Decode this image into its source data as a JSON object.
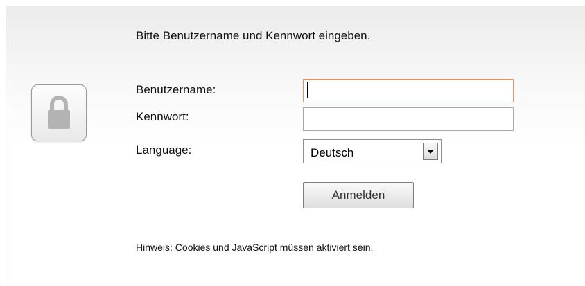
{
  "login": {
    "heading": "Bitte Benutzername und Kennwort eingeben.",
    "username_label": "Benutzername:",
    "username_value": "",
    "password_label": "Kennwort:",
    "password_value": "",
    "language_label": "Language:",
    "language_selected": "Deutsch",
    "submit_label": "Anmelden",
    "hint": "Hinweis: Cookies und JavaScript müssen aktiviert sein.",
    "lock_icon": "lock-icon",
    "dropdown_icon": "chevron-down-icon",
    "focus_border_color": "#e8935a"
  }
}
